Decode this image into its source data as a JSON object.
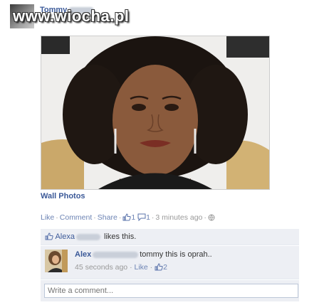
{
  "header": {
    "poster_name": "Tommy",
    "watermark": "www.wiocha.pl"
  },
  "post": {
    "album_link": "Wall Photos",
    "actions": {
      "like": "Like",
      "comment": "Comment",
      "share": "Share",
      "like_count": "1",
      "comment_count": "1",
      "timestamp": "3 minutes ago"
    }
  },
  "likes": {
    "liker": "Alexa",
    "text": "likes this."
  },
  "comment": {
    "author": "Alex",
    "text": "tommy this is oprah..",
    "timestamp": "45 seconds ago",
    "like_label": "Like",
    "like_count": "2"
  },
  "composer": {
    "placeholder": "Write a comment..."
  },
  "colors": {
    "link": "#3b5998",
    "muted_link": "#6d84b4",
    "comment_bg": "#edeff4"
  }
}
